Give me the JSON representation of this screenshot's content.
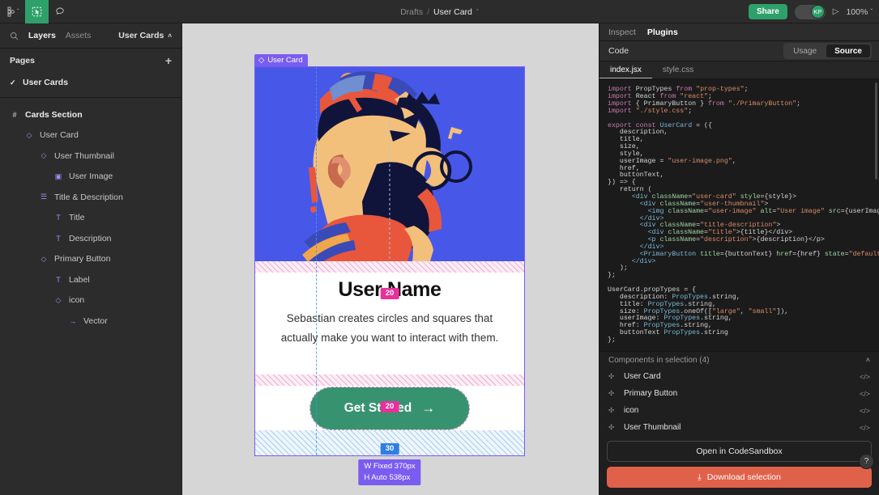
{
  "topbar": {
    "menu_icon": "figma-logo",
    "tools": [
      {
        "name": "move-tool",
        "glyph": "⬚"
      },
      {
        "name": "comment-tool",
        "glyph": "◯"
      }
    ],
    "breadcrumb_root": "Drafts",
    "breadcrumb_sep": "/",
    "breadcrumb_current": "User Card",
    "breadcrumb_caret": "ˇ",
    "share_label": "Share",
    "avatar_initials": "KP",
    "present_icon": "▷",
    "zoom_level": "100%",
    "zoom_caret": "ˇ"
  },
  "left_panel": {
    "search_icon": "search-icon",
    "tabs": [
      {
        "label": "Layers",
        "active": true
      },
      {
        "label": "Assets",
        "active": false
      }
    ],
    "file_name": "User Cards",
    "file_caret": "˄",
    "pages_label": "Pages",
    "add_page": "+",
    "pages": [
      {
        "label": "User Cards",
        "checked": true
      }
    ],
    "layers": [
      {
        "label": "Cards Section",
        "icon": "#",
        "indent": 0,
        "bold": true,
        "icon_color": "grey"
      },
      {
        "label": "User Card",
        "icon": "◇",
        "indent": 1,
        "bold": false,
        "icon_color": "purple"
      },
      {
        "label": "User Thumbnail",
        "icon": "◇",
        "indent": 2,
        "bold": false,
        "icon_color": "purple"
      },
      {
        "label": "User Image",
        "icon": "▣",
        "indent": 3,
        "bold": false,
        "icon_color": "purple"
      },
      {
        "label": "Title & Description",
        "icon": "☰",
        "indent": 2,
        "bold": false,
        "icon_color": "purple"
      },
      {
        "label": "Title",
        "icon": "T",
        "indent": 3,
        "bold": false,
        "icon_color": "purple"
      },
      {
        "label": "Description",
        "icon": "T",
        "indent": 3,
        "bold": false,
        "icon_color": "purple"
      },
      {
        "label": "Primary Button",
        "icon": "◇",
        "indent": 2,
        "bold": false,
        "icon_color": "purple"
      },
      {
        "label": "Label",
        "icon": "T",
        "indent": 3,
        "bold": false,
        "icon_color": "purple"
      },
      {
        "label": "icon",
        "icon": "◇",
        "indent": 3,
        "bold": false,
        "icon_color": "purple"
      },
      {
        "label": "Vector",
        "icon": "→",
        "indent": 4,
        "bold": false,
        "icon_color": "purple"
      }
    ]
  },
  "canvas": {
    "selection_label": "User Card",
    "selection_icon": "◇",
    "card": {
      "title": "User Name",
      "description": "Sebastian creates circles and squares that actually make you want to interact with them.",
      "button_label": "Get Started",
      "button_icon": "→",
      "button_color": "#37936f",
      "thumbnail_bg": "#4758e8"
    },
    "spacing_badges": [
      {
        "value": "20",
        "color": "#e8309b"
      },
      {
        "value": "20",
        "color": "#e8309b"
      },
      {
        "value": "30",
        "color": "#2f7fe0"
      }
    ],
    "dimensions": {
      "width_mode": "W Fixed",
      "width_value": "370px",
      "height_mode": "H Auto",
      "height_value": "538px"
    }
  },
  "right_panel": {
    "tabs": [
      {
        "label": "Inspect",
        "active": false
      },
      {
        "label": "Plugins",
        "active": true
      }
    ],
    "code_label": "Code",
    "segments": [
      {
        "label": "Usage",
        "active": false
      },
      {
        "label": "Source",
        "active": true
      }
    ],
    "file_tabs": [
      {
        "label": "index.jsx",
        "active": true
      },
      {
        "label": "style.css",
        "active": false
      }
    ],
    "code_lines": [
      [
        [
          "import ",
          "k-imp"
        ],
        [
          "PropTypes ",
          "k-id"
        ],
        [
          "from ",
          "k-imp"
        ],
        [
          "\"prop-types\"",
          "k-str"
        ],
        [
          ";",
          "k-pl"
        ]
      ],
      [
        [
          "import ",
          "k-imp"
        ],
        [
          "React ",
          "k-id"
        ],
        [
          "from ",
          "k-imp"
        ],
        [
          "\"react\"",
          "k-str"
        ],
        [
          ";",
          "k-pl"
        ]
      ],
      [
        [
          "import ",
          "k-imp"
        ],
        [
          "{ ",
          "k-pl"
        ],
        [
          "PrimaryButton",
          "k-id"
        ],
        [
          " } ",
          "k-pl"
        ],
        [
          "from ",
          "k-imp"
        ],
        [
          "\"./PrimaryButton\"",
          "k-str"
        ],
        [
          ";",
          "k-pl"
        ]
      ],
      [
        [
          "import ",
          "k-imp"
        ],
        [
          "\"./style.css\"",
          "k-str"
        ],
        [
          ";",
          "k-pl"
        ]
      ],
      [],
      [
        [
          "export ",
          "k-kw"
        ],
        [
          "const ",
          "k-kw"
        ],
        [
          "UserCard ",
          "k-cmp"
        ],
        [
          "= ({",
          "k-pl"
        ]
      ],
      [
        [
          "   description,",
          "k-pl"
        ]
      ],
      [
        [
          "   title,",
          "k-pl"
        ]
      ],
      [
        [
          "   size,",
          "k-pl"
        ]
      ],
      [
        [
          "   style,",
          "k-pl"
        ]
      ],
      [
        [
          "   userImage = ",
          "k-pl"
        ],
        [
          "\"user-image.png\"",
          "k-str"
        ],
        [
          ",",
          "k-pl"
        ]
      ],
      [
        [
          "   href,",
          "k-pl"
        ]
      ],
      [
        [
          "   buttonText,",
          "k-pl"
        ]
      ],
      [
        [
          "}) => {",
          "k-pl"
        ]
      ],
      [
        [
          "   return (",
          "k-pl"
        ]
      ],
      [
        [
          "      <div ",
          "k-tag"
        ],
        [
          "className",
          "k-att"
        ],
        [
          "=",
          "k-pl"
        ],
        [
          "\"user-card\" ",
          "k-str"
        ],
        [
          "style",
          "k-att"
        ],
        [
          "=",
          "k-pl"
        ],
        [
          "{style}>",
          "k-pl"
        ]
      ],
      [
        [
          "        <div ",
          "k-tag"
        ],
        [
          "className",
          "k-att"
        ],
        [
          "=",
          "k-pl"
        ],
        [
          "\"user-thumbnail\"",
          "k-str"
        ],
        [
          ">",
          "k-pl"
        ]
      ],
      [
        [
          "          <img ",
          "k-tag"
        ],
        [
          "className",
          "k-att"
        ],
        [
          "=",
          "k-pl"
        ],
        [
          "\"user-image\" ",
          "k-str"
        ],
        [
          "alt",
          "k-att"
        ],
        [
          "=",
          "k-pl"
        ],
        [
          "\"User image\" ",
          "k-str"
        ],
        [
          "src",
          "k-att"
        ],
        [
          "=",
          "k-pl"
        ],
        [
          "{userImage} />",
          "k-pl"
        ]
      ],
      [
        [
          "        </div>",
          "k-tag"
        ]
      ],
      [
        [
          "        <div ",
          "k-tag"
        ],
        [
          "className",
          "k-att"
        ],
        [
          "=",
          "k-pl"
        ],
        [
          "\"title-description\"",
          "k-str"
        ],
        [
          ">",
          "k-pl"
        ]
      ],
      [
        [
          "          <div ",
          "k-tag"
        ],
        [
          "className",
          "k-att"
        ],
        [
          "=",
          "k-pl"
        ],
        [
          "\"title\"",
          "k-str"
        ],
        [
          ">{title}</div>",
          "k-pl"
        ]
      ],
      [
        [
          "          <p ",
          "k-tag"
        ],
        [
          "className",
          "k-att"
        ],
        [
          "=",
          "k-pl"
        ],
        [
          "\"description\"",
          "k-str"
        ],
        [
          ">{description}</p>",
          "k-pl"
        ]
      ],
      [
        [
          "        </div>",
          "k-tag"
        ]
      ],
      [
        [
          "        <PrimaryButton ",
          "k-cmp"
        ],
        [
          "title",
          "k-att"
        ],
        [
          "=",
          "k-pl"
        ],
        [
          "{buttonText} ",
          "k-pl"
        ],
        [
          "href",
          "k-att"
        ],
        [
          "=",
          "k-pl"
        ],
        [
          "{href} ",
          "k-pl"
        ],
        [
          "state",
          "k-att"
        ],
        [
          "=",
          "k-pl"
        ],
        [
          "\"default\" ",
          "k-str"
        ],
        [
          "/>",
          "k-pl"
        ]
      ],
      [
        [
          "      </div>",
          "k-tag"
        ]
      ],
      [
        [
          "   );",
          "k-pl"
        ]
      ],
      [
        [
          "};",
          "k-pl"
        ]
      ],
      [],
      [
        [
          "UserCard.propTypes = {",
          "k-pl"
        ]
      ],
      [
        [
          "   description: ",
          "k-pl"
        ],
        [
          "PropTypes",
          "k-cmp"
        ],
        [
          ".string,",
          "k-pl"
        ]
      ],
      [
        [
          "   title: ",
          "k-pl"
        ],
        [
          "PropTypes",
          "k-cmp"
        ],
        [
          ".string,",
          "k-pl"
        ]
      ],
      [
        [
          "   size: ",
          "k-pl"
        ],
        [
          "PropTypes",
          "k-cmp"
        ],
        [
          ".oneOf([",
          "k-pl"
        ],
        [
          "\"large\"",
          "k-str"
        ],
        [
          ", ",
          "k-pl"
        ],
        [
          "\"small\"",
          "k-str"
        ],
        [
          "]),",
          "k-pl"
        ]
      ],
      [
        [
          "   userImage: ",
          "k-pl"
        ],
        [
          "PropTypes",
          "k-cmp"
        ],
        [
          ".string,",
          "k-pl"
        ]
      ],
      [
        [
          "   href: ",
          "k-pl"
        ],
        [
          "PropTypes",
          "k-cmp"
        ],
        [
          ".string,",
          "k-pl"
        ]
      ],
      [
        [
          "   buttonText ",
          "k-pl"
        ],
        [
          "PropTypes",
          "k-cmp"
        ],
        [
          ".string",
          "k-pl"
        ]
      ],
      [
        [
          "};",
          "k-pl"
        ]
      ]
    ],
    "components_header": "Components in selection (4)",
    "components_caret": "˄",
    "components": [
      {
        "label": "User Card"
      },
      {
        "label": "Primary Button"
      },
      {
        "label": "icon"
      },
      {
        "label": "User Thumbnail"
      }
    ],
    "sandbox_label": "Open in CodeSandbox",
    "download_label": "Download selection",
    "download_icon": "⤓",
    "help_label": "?"
  }
}
